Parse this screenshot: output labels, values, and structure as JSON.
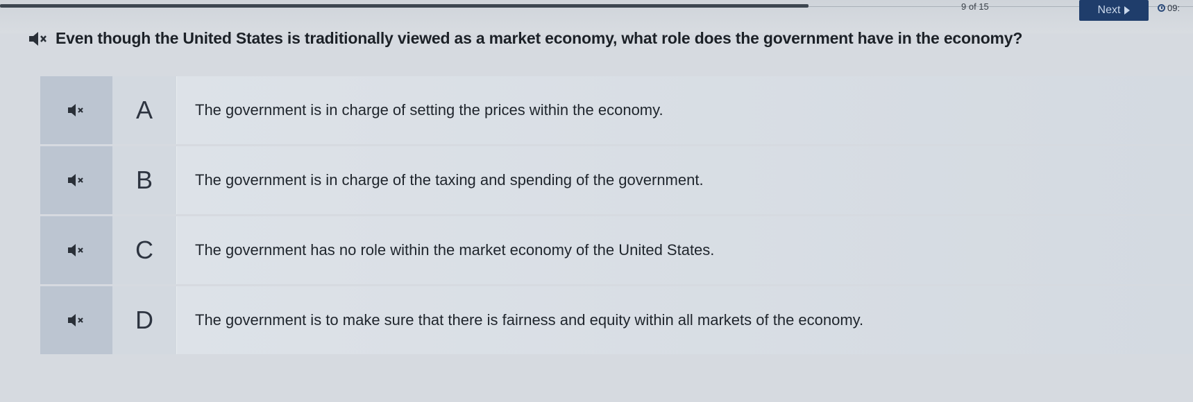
{
  "header": {
    "counter": "9 of 15",
    "next_label": "Next",
    "timer": "09:"
  },
  "question": {
    "text": "Even though the United States is traditionally viewed as a market economy, what role does the government have in the economy?",
    "audio_icon": "speaker-muted-icon"
  },
  "choices": [
    {
      "letter": "A",
      "text": "The government is in charge of setting the prices within the economy."
    },
    {
      "letter": "B",
      "text": "The government is in charge of the taxing and spending of the government."
    },
    {
      "letter": "C",
      "text": "The government has no role within the market economy of the United States."
    },
    {
      "letter": "D",
      "text": "The government is to make sure that there is fairness and equity within all markets of the economy."
    }
  ],
  "colors": {
    "next_button": "#1f3d6b",
    "choice_audio_cell": "#bcc5d1",
    "background": "#d6dae0"
  }
}
